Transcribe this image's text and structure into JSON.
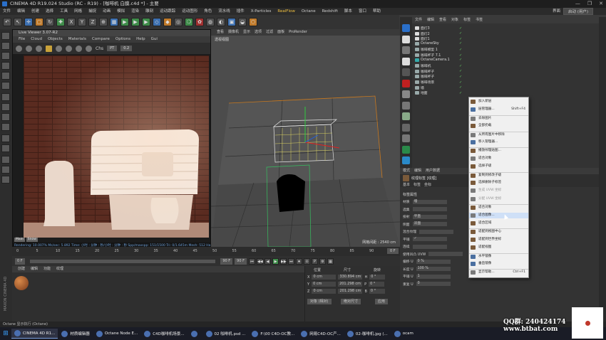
{
  "window": {
    "title": "CINEMA 4D R19.024 Studio (RC - R19) - [咖啡机 白膜.c4d *] - 主要",
    "controls": [
      "—",
      "❐",
      "✕"
    ]
  },
  "menubar": {
    "items": [
      "文件",
      "编辑",
      "创建",
      "选择",
      "工具",
      "网格",
      "捕捉",
      "动画",
      "模拟",
      "渲染",
      "雕刻",
      "运动跟踪",
      "运动图形",
      "角色",
      "流水线",
      "插件",
      "X-Particles",
      "RealFlow",
      "Octane",
      "Redshift",
      "脚本",
      "窗口",
      "帮助"
    ],
    "highlight": "RealFlow",
    "layout_label": "界面",
    "layout_value": "启动 (用户)"
  },
  "toolbar": {
    "buttons": [
      "↶",
      "↖",
      "✛",
      "▢",
      "↻",
      "✚",
      "X",
      "Y",
      "Z",
      "⊕",
      "▦",
      "▶",
      "▶",
      "▶",
      "◇",
      "◆",
      "◎",
      "❍",
      "✿",
      "◍",
      "◐",
      "▣",
      "◒",
      "⬡"
    ]
  },
  "liveviewer": {
    "title": "Live Viewer 3.07-R2",
    "menu": [
      "File",
      "Cloud",
      "Objects",
      "Materials",
      "Compare",
      "Options",
      "Help",
      "Gui"
    ],
    "channel_label": "Chs",
    "channel_value": "PT",
    "zoom": "0.2",
    "badges": [
      "Main",
      "Snow"
    ],
    "status": "Rendering: 10.007%   Ms/sec: 5.892   Time: 小时 : 分钟 : 秒/小时 : 分钟 : 秒   Spp/maxspp: 151/1500   Tri: 0/1.645m   Mesh: 512   Hair: 0",
    "colors": {
      "brick": "#5a2b20",
      "mortar": "#3f1e16",
      "machine": "#f2e6dc"
    }
  },
  "viewport": {
    "menu": [
      "查看",
      "摄像机",
      "显示",
      "选项",
      "过滤",
      "面板",
      "ProRender"
    ],
    "label": "透视视图",
    "distance": "网格间距 : 2540 cm"
  },
  "timeline": {
    "ticks": [
      "0",
      "5",
      "10",
      "15",
      "20",
      "25",
      "30",
      "35",
      "40",
      "45",
      "50",
      "55",
      "60",
      "65",
      "70",
      "75",
      "80",
      "85",
      "90"
    ],
    "current": "0 F",
    "start": "0 F",
    "end": "90 F",
    "range": "90 F"
  },
  "transport": {
    "buttons": [
      "⏮",
      "◀◀",
      "◀",
      "▶",
      "▶▶",
      "⏭",
      "⏺",
      "⊙",
      "P",
      "⚙",
      "▦"
    ]
  },
  "material_panel": {
    "menu": [
      "创建",
      "编辑",
      "功能",
      "纹理"
    ]
  },
  "coords": {
    "headers": [
      "位置",
      "尺寸",
      "旋转"
    ],
    "rows": [
      {
        "axis": "X",
        "pos": "0 cm",
        "size": "330.894 cm",
        "rot": "H",
        "rotv": "0 °"
      },
      {
        "axis": "Y",
        "pos": "0 cm",
        "size": "201.298 cm",
        "rot": "P",
        "rotv": "0 °"
      },
      {
        "axis": "Z",
        "pos": "0 cm",
        "size": "201.298 cm",
        "rot": "B",
        "rotv": "0 °"
      }
    ],
    "mode": "对象 (相对)",
    "size_mode": "绝对尺寸",
    "apply": "应用"
  },
  "objects": {
    "tabs": [
      "文件",
      "编辑",
      "查看",
      "对象",
      "标签",
      "书签"
    ],
    "items": [
      {
        "name": "面灯3",
        "icon": "light"
      },
      {
        "name": "面灯2",
        "icon": "light"
      },
      {
        "name": "面灯1",
        "icon": "light"
      },
      {
        "name": "OctaneSky",
        "icon": "sky"
      },
      {
        "name": "咖啡模型 1",
        "icon": "null"
      },
      {
        "name": "咖啡杯子 7.1",
        "icon": "null"
      },
      {
        "name": "OctaneCamera.1",
        "icon": "camera"
      },
      {
        "name": "咖啡机",
        "icon": "null"
      },
      {
        "name": "咖啡杯子",
        "icon": "null"
      },
      {
        "name": "咖啡杯子",
        "icon": "null"
      },
      {
        "name": "咖啡场景",
        "icon": "null"
      },
      {
        "name": "墙",
        "icon": "null"
      },
      {
        "name": "地面",
        "icon": "null"
      }
    ]
  },
  "attributes": {
    "tabs": [
      "模式",
      "编辑",
      "用户数据"
    ],
    "title": "纹理标签 [纹理]",
    "subtabs": [
      "基本",
      "标签",
      "坐标"
    ],
    "section": "标签属性",
    "rows": [
      {
        "label": "材质",
        "value": "墙"
      },
      {
        "label": "选集",
        "value": ""
      },
      {
        "label": "投射",
        "value": "平直"
      },
      {
        "label": "侧面",
        "value": "双面"
      },
      {
        "label": "混合纹理",
        "value": ""
      },
      {
        "label": "平铺",
        "value": "✓"
      },
      {
        "label": "连续",
        "value": ""
      },
      {
        "label": "使用凹凸 UVW",
        "value": ""
      },
      {
        "label": "偏移 U",
        "value": "0 %"
      },
      {
        "label": "长度 U",
        "value": "100 %"
      },
      {
        "label": "平铺 U",
        "value": "1"
      },
      {
        "label": "重复 U",
        "value": "0"
      }
    ]
  },
  "context_menu": {
    "items": [
      {
        "label": "加入新层",
        "shortcut": "",
        "state": "normal"
      },
      {
        "label": "层管理器...",
        "shortcut": "Shift+F4",
        "state": "normal"
      },
      {
        "label": "去除图片",
        "shortcut": "",
        "state": "sep"
      },
      {
        "label": "全部扔载",
        "shortcut": "",
        "state": "normal"
      },
      {
        "label": "从所有图片中移除",
        "shortcut": "",
        "state": "sep"
      },
      {
        "label": "移入管理器...",
        "shortcut": "",
        "state": "normal"
      },
      {
        "label": "播放纹理贴图...",
        "shortcut": "",
        "state": "sep"
      },
      {
        "label": "适合对象",
        "shortcut": "",
        "state": "normal"
      },
      {
        "label": "选择子级",
        "shortcut": "",
        "state": "normal"
      },
      {
        "label": "复制到修改子级",
        "shortcut": "",
        "state": "sep"
      },
      {
        "label": "选择删除子标签",
        "shortcut": "",
        "state": "normal"
      },
      {
        "label": "生成 UVW 坐标",
        "shortcut": "",
        "state": "dim"
      },
      {
        "label": "分配 UVW 坐标",
        "shortcut": "",
        "state": "dim"
      },
      {
        "label": "适合对象",
        "shortcut": "",
        "state": "sep"
      },
      {
        "label": "适合图像...",
        "shortcut": "",
        "state": "hl"
      },
      {
        "label": "适合区域",
        "shortcut": "",
        "state": "normal"
      },
      {
        "label": "适配到视图中心",
        "shortcut": "",
        "state": "sep"
      },
      {
        "label": "适配到世界坐标",
        "shortcut": "",
        "state": "normal"
      },
      {
        "label": "适配视图",
        "shortcut": "",
        "state": "normal"
      },
      {
        "label": "水平镜像",
        "shortcut": "",
        "state": "sep"
      },
      {
        "label": "垂直镜像",
        "shortcut": "",
        "state": "normal"
      },
      {
        "label": "显示帮助...",
        "shortcut": "Ctrl+F1",
        "state": "sep"
      }
    ]
  },
  "statusbar": {
    "text": "Octane    显示执行 (Octane)"
  },
  "maxon": "MAXON CINEMA 4D",
  "taskbar": {
    "items": [
      {
        "label": "CINEMA 4D R1...",
        "active": true
      },
      {
        "label": "材质编辑器",
        "active": false
      },
      {
        "label": "Octane Node E...",
        "active": false
      },
      {
        "label": "C4D咖啡机场景...",
        "active": false
      },
      {
        "label": "",
        "active": false
      },
      {
        "label": "02 咖啡机.psd ...",
        "active": false
      },
      {
        "label": "F:\\00 C4D-OC教...",
        "active": false
      },
      {
        "label": "网易C4D-OC产...",
        "active": false
      },
      {
        "label": "02-咖啡机.jpg (...",
        "active": false
      },
      {
        "label": "ocam",
        "active": false
      }
    ]
  },
  "watermark": {
    "qq": "QQ群: 240424174",
    "site": "www.btbat.com"
  }
}
